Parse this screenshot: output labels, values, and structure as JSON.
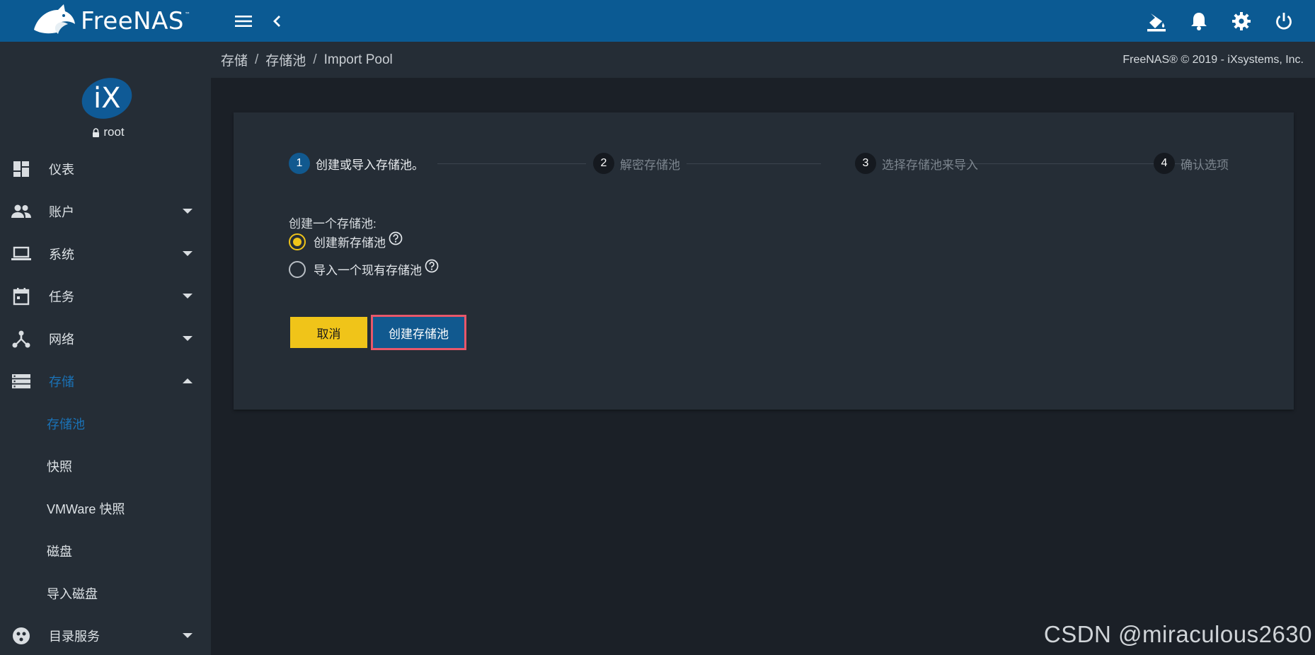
{
  "brand": {
    "name": "FreeNAS",
    "tm": "™"
  },
  "topbar": {
    "icons": [
      "menu-icon",
      "back-icon",
      "theme-icon",
      "bell-icon",
      "gear-icon",
      "power-icon"
    ]
  },
  "profile": {
    "username": "root"
  },
  "sidebar": {
    "items": [
      {
        "label": "仪表",
        "icon": "dashboard-icon"
      },
      {
        "label": "账户",
        "icon": "accounts-icon"
      },
      {
        "label": "系统",
        "icon": "laptop-icon"
      },
      {
        "label": "任务",
        "icon": "calendar-icon"
      },
      {
        "label": "网络",
        "icon": "network-icon"
      },
      {
        "label": "存储",
        "icon": "storage-icon"
      }
    ],
    "sub_items": [
      {
        "label": "存储池"
      },
      {
        "label": "快照"
      },
      {
        "label": "VMWare 快照"
      },
      {
        "label": "磁盘"
      },
      {
        "label": "导入磁盘"
      }
    ],
    "partial_item": {
      "label": "目录服务",
      "icon": "directory-icon"
    }
  },
  "breadcrumb": {
    "items": [
      "存储",
      "存储池",
      "Import Pool"
    ],
    "separator": "/",
    "copyright": "FreeNAS® © 2019 - iXsystems, Inc."
  },
  "stepper": {
    "steps": [
      {
        "num": "1",
        "label": "创建或导入存储池。"
      },
      {
        "num": "2",
        "label": "解密存储池"
      },
      {
        "num": "3",
        "label": "选择存储池来导入"
      },
      {
        "num": "4",
        "label": "确认选项"
      }
    ],
    "active_step": 1
  },
  "form": {
    "title": "创建一个存储池:",
    "options": [
      {
        "label": "创建新存储池",
        "checked": true
      },
      {
        "label": "导入一个现有存储池",
        "checked": false
      }
    ],
    "cancel_label": "取消",
    "create_label": "创建存储池"
  },
  "watermark": "CSDN @miraculous2630",
  "colors": {
    "topbar": "#0b5a93",
    "sidebar": "#252d36",
    "background": "#1b2027",
    "accent_yellow": "#f0c419",
    "primary_blue": "#11598f",
    "highlight_border": "#e8576a",
    "active_nav": "#1a73b8"
  }
}
